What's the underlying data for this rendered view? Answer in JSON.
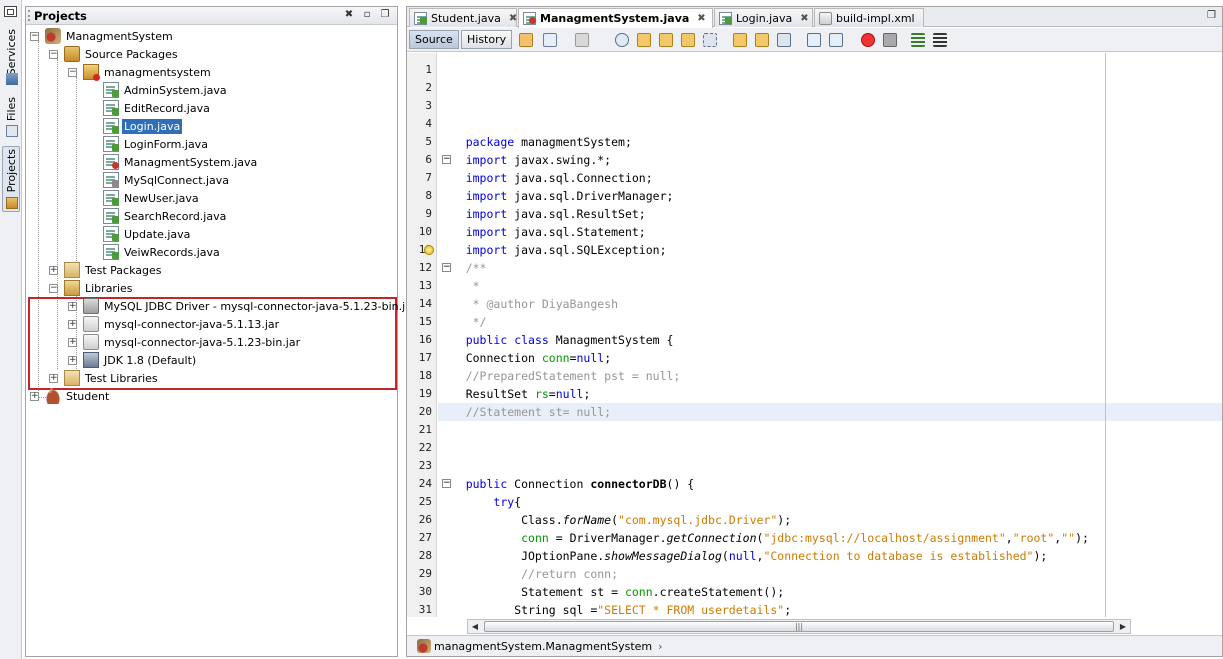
{
  "side_strip": {
    "tabs": [
      {
        "label": "Services",
        "icon": "services-icon"
      },
      {
        "label": "Files",
        "icon": "files-icon"
      },
      {
        "label": "Projects",
        "icon": "projects-icon",
        "active": true
      }
    ]
  },
  "projects_panel": {
    "title": "Projects",
    "tree": [
      {
        "label": "ManagmentSystem",
        "icon": "project-icon",
        "level": 0,
        "toggle": "-"
      },
      {
        "label": "Source Packages",
        "icon": "source-packages-icon",
        "level": 1,
        "toggle": "-"
      },
      {
        "label": "managmentsystem",
        "icon": "package-icon",
        "level": 2,
        "toggle": "-"
      },
      {
        "label": "AdminSystem.java",
        "icon": "java-file-icon",
        "level": 3
      },
      {
        "label": "EditRecord.java",
        "icon": "java-file-icon",
        "level": 3
      },
      {
        "label": "Login.java",
        "icon": "java-file-icon",
        "level": 3,
        "selected": true
      },
      {
        "label": "LoginForm.java",
        "icon": "java-file-icon",
        "level": 3
      },
      {
        "label": "ManagmentSystem.java",
        "icon": "java-file-error-icon",
        "level": 3
      },
      {
        "label": "MySqlConnect.java",
        "icon": "java-file-icon",
        "level": 3
      },
      {
        "label": "NewUser.java",
        "icon": "java-file-icon",
        "level": 3
      },
      {
        "label": "SearchRecord.java",
        "icon": "java-file-icon",
        "level": 3
      },
      {
        "label": "Update.java",
        "icon": "java-file-icon",
        "level": 3
      },
      {
        "label": "VeiwRecords.java",
        "icon": "java-file-icon",
        "level": 3
      },
      {
        "label": "Test Packages",
        "icon": "test-packages-icon",
        "level": 1,
        "toggle": "+"
      },
      {
        "label": "Libraries",
        "icon": "libraries-icon",
        "level": 1,
        "toggle": "-"
      },
      {
        "label": "MySQL JDBC Driver - mysql-connector-java-5.1.23-bin.jar",
        "icon": "jar-icon",
        "level": 2,
        "toggle": "+"
      },
      {
        "label": "mysql-connector-java-5.1.13.jar",
        "icon": "jar-icon",
        "level": 2,
        "toggle": "+"
      },
      {
        "label": "mysql-connector-java-5.1.23-bin.jar",
        "icon": "jar-icon",
        "level": 2,
        "toggle": "+"
      },
      {
        "label": "JDK 1.8 (Default)",
        "icon": "jdk-icon",
        "level": 2,
        "toggle": "+"
      },
      {
        "label": "Test Libraries",
        "icon": "test-libraries-icon",
        "level": 1,
        "toggle": "+"
      },
      {
        "label": "Student",
        "icon": "coffee-cup-icon",
        "level": 0,
        "toggle": "+"
      }
    ]
  },
  "editor": {
    "tabs": [
      {
        "label": "Student.java",
        "icon": "java-file-icon"
      },
      {
        "label": "ManagmentSystem.java",
        "icon": "java-file-error-icon",
        "active": true
      },
      {
        "label": "Login.java",
        "icon": "java-file-icon"
      },
      {
        "label": "build-impl.xml",
        "icon": "xml-file-icon"
      }
    ],
    "toolbar": {
      "source_label": "Source",
      "history_label": "History"
    },
    "line_numbers": [
      "1",
      "2",
      "3",
      "4",
      "5",
      "6",
      "7",
      "8",
      "9",
      "10",
      "11",
      "12",
      "13",
      "14",
      "15",
      "16",
      "17",
      "18",
      "19",
      "20",
      "21",
      "22",
      "23",
      "24",
      "25",
      "26",
      "27",
      "28",
      "29",
      "30",
      "31"
    ],
    "code_lines": [
      "",
      "",
      "",
      "",
      "package managmentSystem;",
      "import javax.swing.*;",
      "import java.sql.Connection;",
      "import java.sql.DriverManager;",
      "import java.sql.ResultSet;",
      "import java.sql.Statement;",
      "import java.sql.SQLException;",
      "/**",
      " *",
      " * @author DiyaBangesh",
      " */",
      "public class ManagmentSystem {",
      "Connection conn=null;",
      "//PreparedStatement pst = null;",
      "ResultSet rs=null;",
      "//Statement st= null;",
      "",
      "",
      "",
      "public Connection connectorDB() {",
      "    try{",
      "        Class.forName(\"com.mysql.jdbc.Driver\");",
      "        conn = DriverManager.getConnection(\"jdbc:mysql://localhost/assignment\",\"root\",\"\");",
      "        JOptionPane.showMessageDialog(null,\"Connection to database is established\");",
      "        //return conn;",
      "        Statement st = conn.createStatement();",
      "       String sql =\"SELECT * FROM userdetails\";"
    ],
    "navigator_path": "managmentSystem.ManagmentSystem"
  }
}
